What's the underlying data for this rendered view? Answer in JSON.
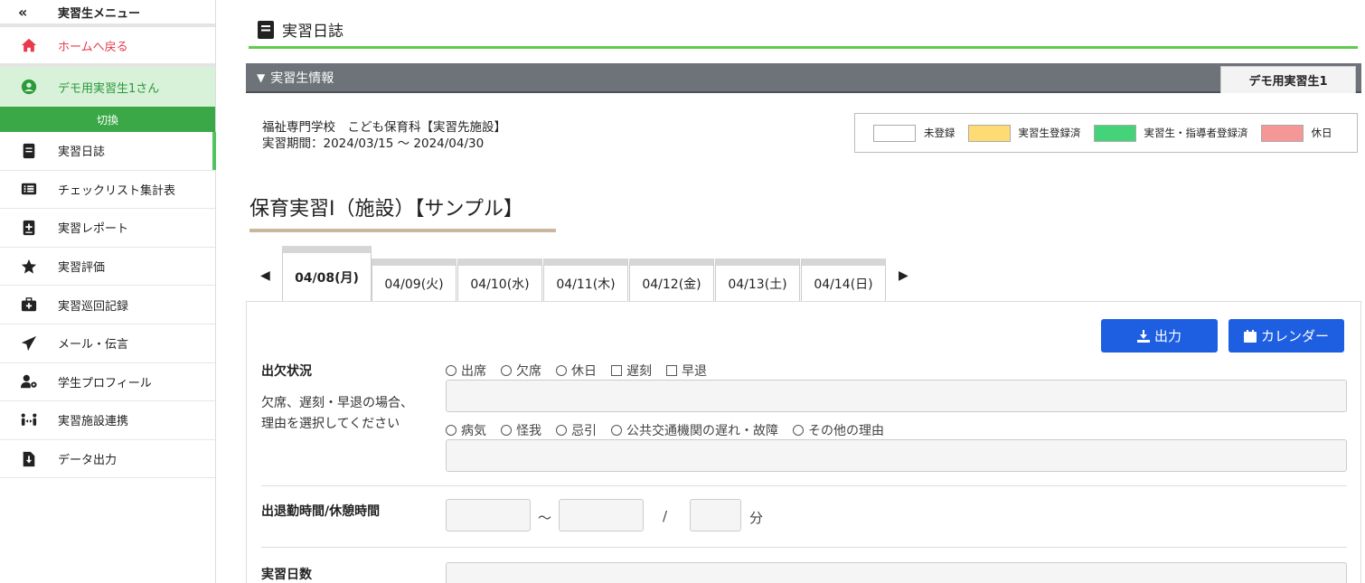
{
  "sidebar": {
    "collapse_icon": "«",
    "menu_title": "実習生メニュー",
    "home_label": "ホームへ戻る",
    "user_label": "デモ用実習生1さん",
    "switch_label": "切換",
    "items": [
      {
        "label": "実習日誌",
        "icon": "notebook-icon"
      },
      {
        "label": "チェックリスト集計表",
        "icon": "list-icon"
      },
      {
        "label": "実習レポート",
        "icon": "report-plus-icon"
      },
      {
        "label": "実習評価",
        "icon": "star-icon"
      },
      {
        "label": "実習巡回記録",
        "icon": "medkit-icon"
      },
      {
        "label": "メール・伝言",
        "icon": "paper-plane-icon"
      },
      {
        "label": "学生プロフィール",
        "icon": "user-gear-icon"
      },
      {
        "label": "実習施設連携",
        "icon": "people-arrows-icon"
      },
      {
        "label": "データ出力",
        "icon": "file-download-icon"
      }
    ]
  },
  "page": {
    "title": "実習日誌",
    "info_bar_label": "実習生情報",
    "student_tab": "デモ用実習生1",
    "school_line": "福祉専門学校　こども保育科【実習先施設】",
    "period_line": "実習期間：2024/03/15 ～ 2024/04/30",
    "course_title": "保育実習Ⅰ（施設）【サンプル】"
  },
  "legend": [
    {
      "label": "未登録",
      "color": "#ffffff"
    },
    {
      "label": "実習生登録済",
      "color": "#ffdc73"
    },
    {
      "label": "実習生・指導者登録済",
      "color": "#45d37a"
    },
    {
      "label": "休日",
      "color": "#f59797"
    }
  ],
  "tabs": [
    "04/08(月)",
    "04/09(火)",
    "04/10(水)",
    "04/11(木)",
    "04/12(金)",
    "04/13(土)",
    "04/14(日)"
  ],
  "active_tab": 0,
  "buttons": {
    "export": "出力",
    "calendar": "カレンダー"
  },
  "form": {
    "attendance_label": "出欠状況",
    "attendance_radios": [
      "出席",
      "欠席",
      "休日"
    ],
    "attendance_checks": [
      "遅刻",
      "早退"
    ],
    "reason_desc": "欠席、遅刻・早退の場合、理由を選択してください",
    "reasons": [
      "病気",
      "怪我",
      "忌引",
      "公共交通機関の遅れ・故障",
      "その他の理由"
    ],
    "time_label": "出退勤時間/休憩時間",
    "time_sep": "～",
    "slash": "/",
    "minute_unit": "分",
    "days_label": "実習日数"
  },
  "colors": {
    "accent": "#5dcb4b",
    "home": "#e83a4a",
    "button": "#1d5fe0"
  }
}
